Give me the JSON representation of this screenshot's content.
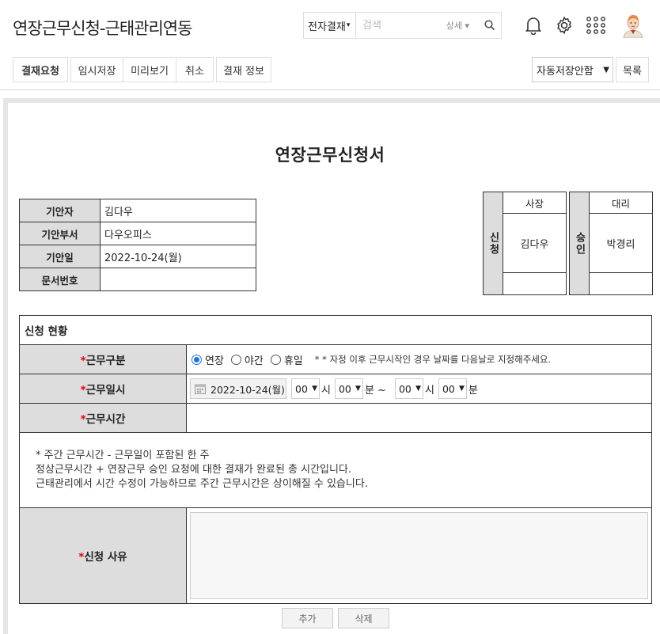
{
  "header": {
    "title": "연장근무신청-근태관리연동",
    "search": {
      "scope": "전자결재",
      "placeholder": "검색",
      "detail": "상세"
    }
  },
  "icons": {
    "bell": "bell-icon",
    "gear": "gear-icon",
    "apps": "apps-grid-icon",
    "avatar": "avatar"
  },
  "toolbar": {
    "request": "결재요청",
    "temp_save": "임시저장",
    "preview": "미리보기",
    "cancel": "취소",
    "approval_info": "결재 정보",
    "autosave": "자동저장안함",
    "list": "목록"
  },
  "document": {
    "title": "연장근무신청서",
    "info": [
      {
        "label": "기안자",
        "value": "김다우"
      },
      {
        "label": "기안부서",
        "value": "다우오피스"
      },
      {
        "label": "기안일",
        "value": "2022-10-24(월)"
      },
      {
        "label": "문서번호",
        "value": ""
      }
    ],
    "apply_box": {
      "side": "신청",
      "role": "사장",
      "name": "김다우"
    },
    "approve_box": {
      "side": "승인",
      "role": "대리",
      "name": "박경리"
    }
  },
  "request": {
    "section_title": "신청 현황",
    "required_mark": "*",
    "work_type": {
      "label": "근무구분",
      "options": [
        "연장",
        "야간",
        "휴일"
      ],
      "selected": "연장",
      "hint": "* * 자정 이후 근무시작인 경우 날짜를 다음날로 지정해주세요."
    },
    "work_datetime": {
      "label": "근무일시",
      "date": "2022-10-24(월)",
      "start_hour": "00",
      "start_min": "00",
      "end_hour": "00",
      "end_min": "00",
      "unit_hour": "시",
      "unit_min": "분",
      "separator": "~"
    },
    "work_time": {
      "label": "근무시간",
      "value": ""
    },
    "notes": [
      "* 주간 근무시간 - 근무일이 포함된 한 주",
      "정상근무시간 + 연장근무 승인 요청에 대한 결재가 완료된 총 시간입니다.",
      "근태관리에서 시간 수정이 가능하므로 주간 근무시간은 상이해질 수 있습니다."
    ],
    "reason": {
      "label": "신청 사유",
      "value": ""
    }
  },
  "actions": {
    "add": "추가",
    "delete": "삭제"
  }
}
